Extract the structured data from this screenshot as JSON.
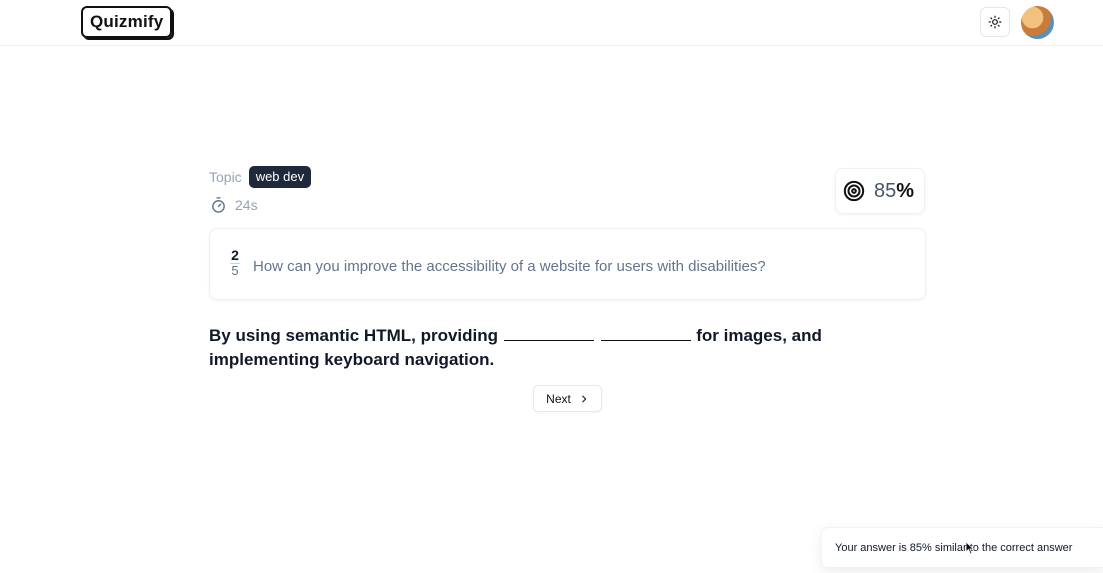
{
  "app": {
    "logo": "Quizmify"
  },
  "header": {
    "theme_icon": "sun-icon",
    "avatar_icon": "user-avatar"
  },
  "quiz": {
    "topic_label": "Topic",
    "topic": "web dev",
    "timer": "24s",
    "score": "85",
    "score_unit": "%",
    "question_current": "2",
    "question_total": "5",
    "question": "How can you improve the accessibility of a website for users with disabilities?",
    "answer_before": "By using semantic HTML, providing",
    "answer_after": "for images, and implementing keyboard navigation.",
    "next_label": "Next"
  },
  "toast": {
    "message": "Your answer is 85% similar to the correct answer"
  },
  "colors": {
    "badge_bg": "#1e293b",
    "muted": "#94a3b8",
    "text": "#0f172a"
  }
}
